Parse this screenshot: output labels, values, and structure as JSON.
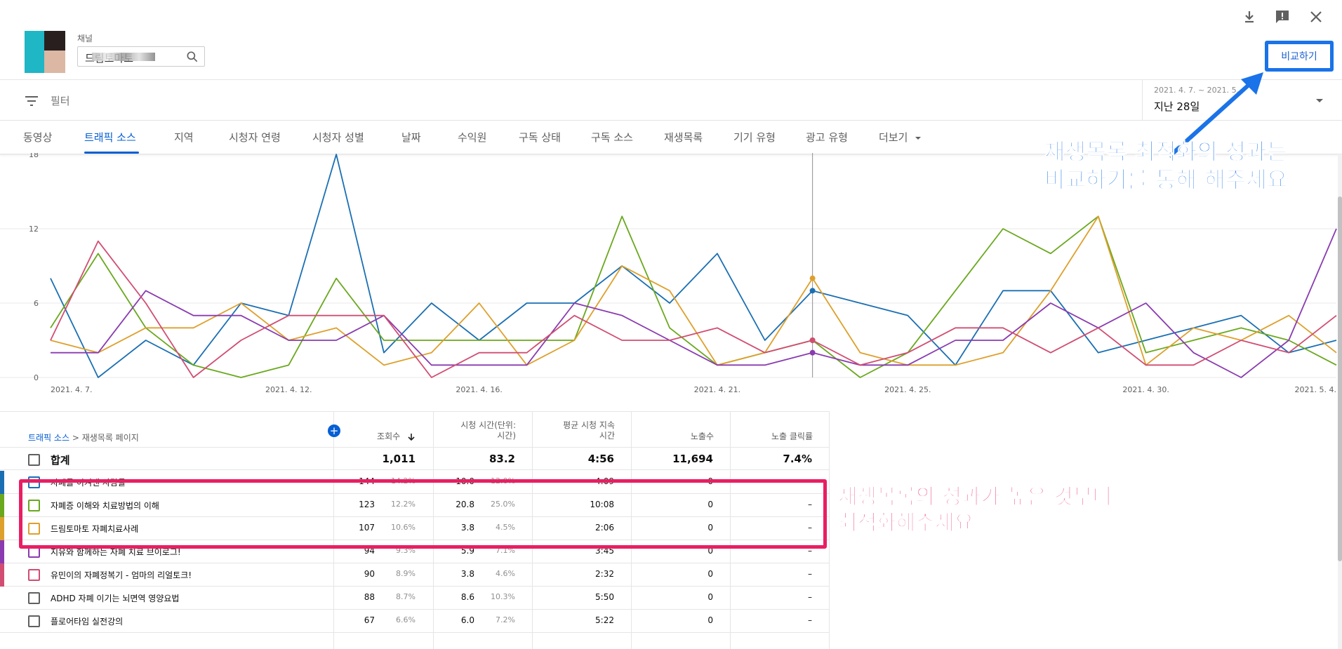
{
  "header": {
    "channel_label": "채널",
    "channel_name": "드림토마토",
    "compare_label": "비교하기"
  },
  "filter": {
    "label": "필터",
    "date_range": "2021. 4. 7. ~ 2021. 5.",
    "date_period": "지난 28일"
  },
  "tabs": [
    {
      "label": "동영상"
    },
    {
      "label": "트래픽 소스"
    },
    {
      "label": "지역"
    },
    {
      "label": "시청자 연령"
    },
    {
      "label": "시청자 성별"
    },
    {
      "label": "날짜"
    },
    {
      "label": "수익원"
    },
    {
      "label": "구독 상태"
    },
    {
      "label": "구독 소스"
    },
    {
      "label": "재생목록"
    },
    {
      "label": "기기 유형"
    },
    {
      "label": "광고 유형"
    },
    {
      "label": "더보기"
    }
  ],
  "colors": {
    "blue": "#1a6fb3",
    "green": "#6aa81e",
    "orange": "#dea02c",
    "purple": "#8a3bb0",
    "pink": "#d14d72",
    "annotation_blue": "#1a73e8",
    "annotation_pink": "#e91e63"
  },
  "annotations": {
    "compare_line1": "재생목록 최적화의 성과는",
    "compare_line2": "비교하기를 통해 해주세요",
    "table_line1": "재생목록의 성과가 높은 것부터",
    "table_line2": "최적화해주세요"
  },
  "chart_data": {
    "type": "line",
    "x": [
      "2021. 4. 7.",
      "4.8",
      "4.9",
      "4.10",
      "4.11",
      "4.12",
      "4.13",
      "4.14",
      "4.15",
      "4.16",
      "4.17",
      "4.18",
      "4.19",
      "4.20",
      "4.21",
      "4.22",
      "4.23",
      "4.24",
      "4.25",
      "4.26",
      "4.27",
      "4.28",
      "4.29",
      "4.30",
      "5.1",
      "5.2",
      "5.3",
      "5.4"
    ],
    "x_tick_labels": [
      {
        "index": 0,
        "label": "2021. 4. 7."
      },
      {
        "index": 5,
        "label": "2021. 4. 12."
      },
      {
        "index": 9,
        "label": "2021. 4. 16."
      },
      {
        "index": 14,
        "label": "2021. 4. 21."
      },
      {
        "index": 18,
        "label": "2021. 4. 25."
      },
      {
        "index": 23,
        "label": "2021. 4. 30."
      },
      {
        "index": 27,
        "label": "2021. 5. 4."
      }
    ],
    "y_ticks": [
      0,
      6,
      12,
      18
    ],
    "ylim": [
      0,
      18
    ],
    "hover_index": 16,
    "series": [
      {
        "color": "#1a6fb3",
        "values": [
          8,
          0,
          3,
          1,
          6,
          5,
          18,
          2,
          6,
          3,
          6,
          6,
          9,
          6,
          10,
          3,
          7,
          6,
          5,
          1,
          7,
          7,
          2,
          3,
          4,
          5,
          2,
          3
        ]
      },
      {
        "color": "#6aa81e",
        "values": [
          4,
          10,
          4,
          1,
          0,
          1,
          8,
          3,
          3,
          3,
          3,
          3,
          13,
          4,
          1,
          2,
          3,
          0,
          2,
          7,
          12,
          10,
          13,
          2,
          3,
          4,
          3,
          1
        ]
      },
      {
        "color": "#dea02c",
        "values": [
          3,
          2,
          4,
          4,
          6,
          3,
          4,
          1,
          2,
          6,
          1,
          3,
          9,
          7,
          1,
          2,
          8,
          2,
          1,
          1,
          2,
          7,
          13,
          1,
          4,
          3,
          5,
          2
        ]
      },
      {
        "color": "#8a3bb0",
        "values": [
          2,
          2,
          7,
          5,
          5,
          3,
          3,
          5,
          1,
          1,
          1,
          6,
          5,
          3,
          1,
          1,
          2,
          1,
          1,
          3,
          3,
          6,
          4,
          6,
          2,
          0,
          3,
          12
        ]
      },
      {
        "color": "#d14d72",
        "values": [
          3,
          11,
          6,
          0,
          3,
          5,
          5,
          5,
          0,
          2,
          2,
          5,
          3,
          3,
          4,
          2,
          3,
          1,
          2,
          4,
          4,
          2,
          4,
          1,
          1,
          3,
          2,
          5
        ]
      }
    ]
  },
  "table": {
    "breadcrumb_root": "트래픽 소스",
    "breadcrumb_sep": " > ",
    "breadcrumb_leaf": "재생목록 페이지",
    "headers": {
      "views": "조회수",
      "watch_time_1": "시청 시간(단위:",
      "watch_time_2": "시간)",
      "avg_duration_1": "평균 시청 지속",
      "avg_duration_2": "시간",
      "impressions": "노출수",
      "ctr": "노출 클릭률"
    },
    "total": {
      "label": "합계",
      "views": "1,011",
      "watch": "83.2",
      "avg": "4:56",
      "impressions": "11,694",
      "ctr": "7.4%"
    },
    "rows": [
      {
        "color": "#1a6fb3",
        "name": "자폐를 이겨낸 사람들",
        "views": "144",
        "views_pct": "14.2%",
        "watch": "10.0",
        "watch_pct": "12.0%",
        "avg": "4:09",
        "impressions": "0",
        "ctr": "–"
      },
      {
        "color": "#6aa81e",
        "name": "자폐증 이해와 치료방법의 이해",
        "views": "123",
        "views_pct": "12.2%",
        "watch": "20.8",
        "watch_pct": "25.0%",
        "avg": "10:08",
        "impressions": "0",
        "ctr": "–"
      },
      {
        "color": "#dea02c",
        "name": "드림토마토 자폐치료사례",
        "views": "107",
        "views_pct": "10.6%",
        "watch": "3.8",
        "watch_pct": "4.5%",
        "avg": "2:06",
        "impressions": "0",
        "ctr": "–"
      },
      {
        "color": "#8a3bb0",
        "name": "지유와 함께하는 자폐 치료 브이로그!",
        "views": "94",
        "views_pct": "9.3%",
        "watch": "5.9",
        "watch_pct": "7.1%",
        "avg": "3:45",
        "impressions": "0",
        "ctr": "–"
      },
      {
        "color": "#d14d72",
        "name": "유민이의 자폐정복기 - 엄마의 리얼토크!",
        "views": "90",
        "views_pct": "8.9%",
        "watch": "3.8",
        "watch_pct": "4.6%",
        "avg": "2:32",
        "impressions": "0",
        "ctr": "–"
      },
      {
        "color": "",
        "name": "ADHD 자폐 이기는 뇌면역 영양요법",
        "views": "88",
        "views_pct": "8.7%",
        "watch": "8.6",
        "watch_pct": "10.3%",
        "avg": "5:50",
        "impressions": "0",
        "ctr": "–"
      },
      {
        "color": "",
        "name": "플로어타임 실전강의",
        "views": "67",
        "views_pct": "6.6%",
        "watch": "6.0",
        "watch_pct": "7.2%",
        "avg": "5:22",
        "impressions": "0",
        "ctr": "–"
      }
    ]
  }
}
